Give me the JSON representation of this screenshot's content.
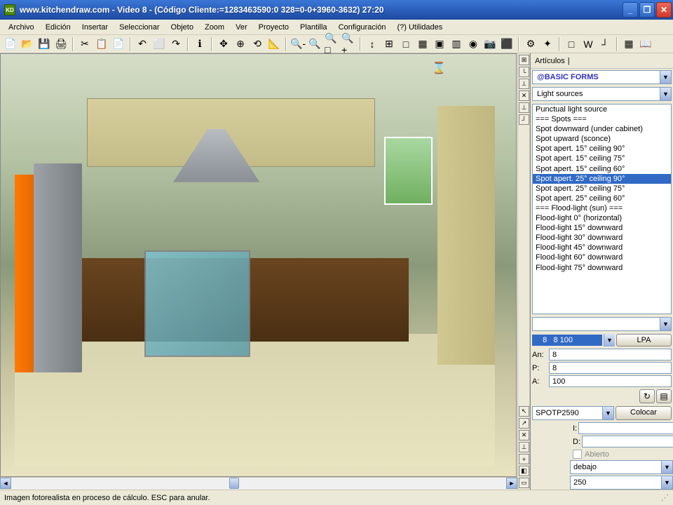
{
  "titlebar": {
    "app_icon_text": "KD",
    "title": "www.kitchendraw.com - Video 8 - (Código Cliente:=1283463590:0 328=0-0+3960-3632) 27:20"
  },
  "menu": [
    "Archivo",
    "Edición",
    "Insertar",
    "Seleccionar",
    "Objeto",
    "Zoom",
    "Ver",
    "Proyecto",
    "Plantilla",
    "Configuración",
    "(?) Utilidades"
  ],
  "toolbar": {
    "icons": [
      "📄",
      "📂",
      "💾",
      "🖨",
      "|",
      "✂",
      "📋",
      "📄",
      "|",
      "↶",
      "⬜",
      "↷",
      "|",
      "ℹ",
      "|",
      "✥",
      "⊕",
      "⟲",
      "📐",
      "|",
      "🔍-",
      "🔍",
      "🔍□",
      "🔍+",
      "|",
      "↕",
      "⊞",
      "□",
      "▦",
      "▣",
      "▥",
      "◉",
      "📷",
      "⬛",
      "|",
      "⚙",
      "✦",
      "|",
      "□",
      "W",
      "┘",
      "|",
      "▦",
      "📖"
    ]
  },
  "vert_icons": [
    "⊞",
    "└",
    "⟂",
    "✕",
    "⊥",
    "┘"
  ],
  "vert_icons_bottom": [
    "↖",
    "↗",
    "✕",
    "⊥",
    "+",
    "◧",
    "▭"
  ],
  "panel": {
    "header": "Artículos",
    "catalog": "@BASIC FORMS",
    "category": "Light sources",
    "items": [
      {
        "label": "Punctual light source",
        "sel": false
      },
      {
        "label": "=== Spots ===",
        "sel": false
      },
      {
        "label": "Spot downward (under cabinet)",
        "sel": false
      },
      {
        "label": "Spot upward (sconce)",
        "sel": false
      },
      {
        "label": "Spot apert. 15° ceiling 90°",
        "sel": false
      },
      {
        "label": "Spot apert. 15° ceiling 75°",
        "sel": false
      },
      {
        "label": "Spot apert. 15° ceiling 60°",
        "sel": false
      },
      {
        "label": "Spot apert. 25° ceiling 90°",
        "sel": true
      },
      {
        "label": "Spot apert. 25° ceiling 75°",
        "sel": false
      },
      {
        "label": "Spot apert. 25° ceiling 60°",
        "sel": false
      },
      {
        "label": "=== Flood-light (sun) ===",
        "sel": false
      },
      {
        "label": "Flood-light 0° (horizontal)",
        "sel": false
      },
      {
        "label": "Flood-light 15° downward",
        "sel": false
      },
      {
        "label": "Flood-light 30° downward",
        "sel": false
      },
      {
        "label": "Flood-light 45° downward",
        "sel": false
      },
      {
        "label": "Flood-light 60° downward",
        "sel": false
      },
      {
        "label": "Flood-light 75° downward",
        "sel": false
      }
    ],
    "lpa_box": "   8   8 100",
    "lpa_btn": "LPA",
    "dims": {
      "an_label": "An:",
      "an_val": "8",
      "p_label": "P:",
      "p_val": "8",
      "a_label": "A:",
      "a_val": "100"
    },
    "code": "SPOTP2590",
    "place_btn": "Colocar",
    "pos": {
      "i_label": "I:",
      "i_val": "",
      "d_label": "D:",
      "d_val": ""
    },
    "open_checkbox": "Abierto",
    "align_sel": "debajo",
    "height_sel": "250"
  },
  "status": "Imagen fotorealista en proceso de cálculo. ESC para anular."
}
